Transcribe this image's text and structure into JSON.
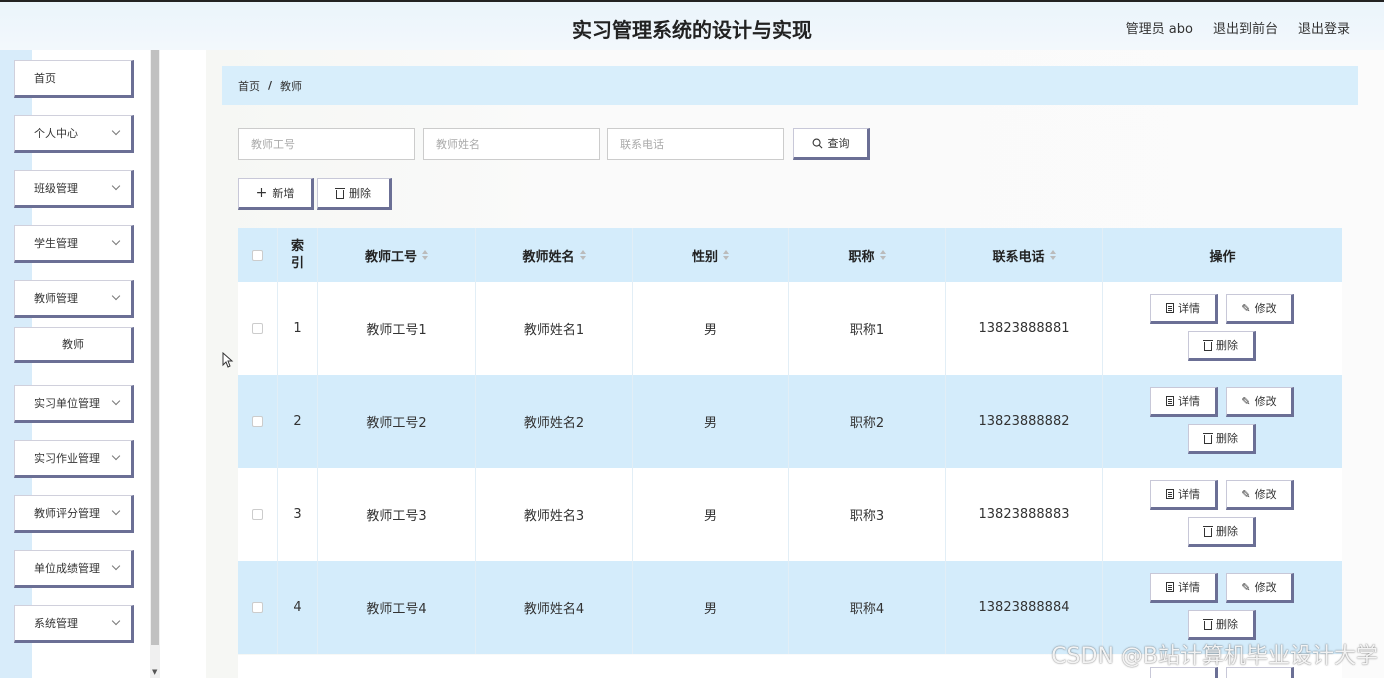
{
  "header": {
    "title": "实习管理系统的设计与实现",
    "user_label": "管理员 abo",
    "front_link": "退出到前台",
    "logout_link": "退出登录"
  },
  "sidebar": {
    "items": [
      {
        "label": "首页"
      },
      {
        "label": "个人中心"
      },
      {
        "label": "班级管理"
      },
      {
        "label": "学生管理"
      },
      {
        "label": "教师管理"
      },
      {
        "label": "教师"
      },
      {
        "label": "实习单位管理"
      },
      {
        "label": "实习作业管理"
      },
      {
        "label": "教师评分管理"
      },
      {
        "label": "单位成绩管理"
      },
      {
        "label": "系统管理"
      }
    ]
  },
  "breadcrumb": {
    "home": "首页",
    "separator": "/",
    "current": "教师"
  },
  "search": {
    "teacher_id_placeholder": "教师工号",
    "teacher_name_placeholder": "教师姓名",
    "phone_placeholder": "联系电话",
    "query_label": "查询"
  },
  "actions": {
    "add_label": "新增",
    "delete_label": "删除"
  },
  "table": {
    "headers": {
      "index_top": "索",
      "index_bottom": "引",
      "teacher_id": "教师工号",
      "teacher_name": "教师姓名",
      "gender": "性别",
      "title": "职称",
      "phone": "联系电话",
      "ops": "操作"
    },
    "rows": [
      {
        "index": "1",
        "teacher_id": "教师工号1",
        "teacher_name": "教师姓名1",
        "gender": "男",
        "title": "职称1",
        "phone": "13823888881"
      },
      {
        "index": "2",
        "teacher_id": "教师工号2",
        "teacher_name": "教师姓名2",
        "gender": "男",
        "title": "职称2",
        "phone": "13823888882"
      },
      {
        "index": "3",
        "teacher_id": "教师工号3",
        "teacher_name": "教师姓名3",
        "gender": "男",
        "title": "职称3",
        "phone": "13823888883"
      },
      {
        "index": "4",
        "teacher_id": "教师工号4",
        "teacher_name": "教师姓名4",
        "gender": "男",
        "title": "职称4",
        "phone": "13823888884"
      }
    ],
    "row_actions": {
      "detail": "详情",
      "edit": "修改",
      "delete": "删除"
    }
  },
  "watermark": "CSDN @B站计算机毕业设计大学"
}
